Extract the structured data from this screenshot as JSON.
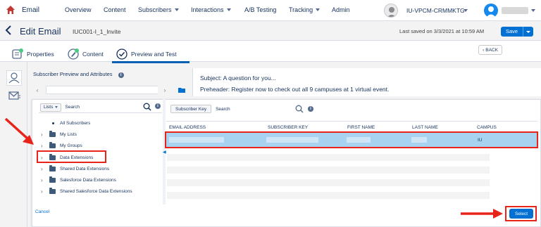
{
  "topnav": {
    "app_name": "Email",
    "items": [
      {
        "label": "Overview",
        "dropdown": false
      },
      {
        "label": "Content",
        "dropdown": false
      },
      {
        "label": "Subscribers",
        "dropdown": true
      },
      {
        "label": "Interactions",
        "dropdown": true
      },
      {
        "label": "A/B Testing",
        "dropdown": false
      },
      {
        "label": "Tracking",
        "dropdown": true
      },
      {
        "label": "Admin",
        "dropdown": false
      }
    ],
    "business_unit": "IU-VPCM-CRMMKTG"
  },
  "header": {
    "title": "Edit Email",
    "email_id": "IUC001-I_1_Invite",
    "last_saved": "Last saved on 3/3/2021 at 10:59 AM",
    "save_label": "Save"
  },
  "tabs": [
    {
      "label": "Properties"
    },
    {
      "label": "Content"
    },
    {
      "label": "Preview and Test",
      "active": true
    }
  ],
  "back_label": "BACK",
  "subscriber_panel": {
    "title": "Subscriber Preview and Attributes"
  },
  "preview": {
    "subject_label": "Subject:",
    "subject_value": "A question for you...",
    "preheader_label": "Preheader:",
    "preheader_value": "Register now to check out all 9 campuses at 1 virtual event."
  },
  "modal": {
    "lists_label": "Lists",
    "search_label": "Search",
    "tree": [
      {
        "label": "All Subscribers",
        "type": "bullet"
      },
      {
        "label": "My Lists",
        "type": "folder"
      },
      {
        "label": "My Groups",
        "type": "folder"
      },
      {
        "label": "Data Extensions",
        "type": "folder"
      },
      {
        "label": "Shared Data Extensions",
        "type": "folder"
      },
      {
        "label": "Salesforce Data Extensions",
        "type": "folder"
      },
      {
        "label": "Shared Salesforce Data Extensions",
        "type": "folder"
      }
    ],
    "key_filter_label": "Subscriber Key",
    "key_search_label": "Search",
    "columns": [
      "EMAIL ADDRESS",
      "SUBSCRIBER KEY",
      "FIRST NAME",
      "LAST NAME",
      "CAMPUS"
    ],
    "selected_row": {
      "campus": "IU"
    },
    "cancel_label": "Cancel",
    "select_label": "Select"
  },
  "colors": {
    "brand_blue": "#0070d2",
    "navy": "#16325c",
    "selected_row": "#a8d3f0",
    "annotation_red": "#e8231a"
  }
}
